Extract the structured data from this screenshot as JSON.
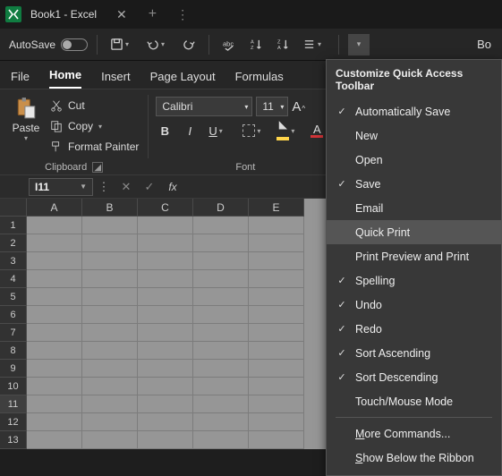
{
  "titlebar": {
    "doc": "Book1 - Excel"
  },
  "qat": {
    "autosave": "AutoSave",
    "toggle_state": "Off",
    "right_text": "Bo"
  },
  "tabs": [
    "File",
    "Home",
    "Insert",
    "Page Layout",
    "Formulas"
  ],
  "active_tab": 1,
  "clipboard": {
    "paste": "Paste",
    "cut": "Cut",
    "copy": "Copy",
    "format_painter": "Format Painter",
    "group_label": "Clipboard"
  },
  "font": {
    "name": "Calibri",
    "size": "11",
    "group_label": "Font"
  },
  "namebox": {
    "ref": "I11",
    "fx": "fx"
  },
  "columns": [
    "A",
    "B",
    "C",
    "D",
    "E"
  ],
  "rows": [
    "1",
    "2",
    "3",
    "4",
    "5",
    "6",
    "7",
    "8",
    "9",
    "10",
    "11",
    "12",
    "13"
  ],
  "selected_row": 11,
  "dropdown": {
    "title": "Customize Quick Access Toolbar",
    "items": [
      {
        "label": "Automatically Save",
        "checked": true
      },
      {
        "label": "New",
        "checked": false
      },
      {
        "label": "Open",
        "checked": false
      },
      {
        "label": "Save",
        "checked": true
      },
      {
        "label": "Email",
        "checked": false
      },
      {
        "label": "Quick Print",
        "checked": false,
        "hover": true
      },
      {
        "label": "Print Preview and Print",
        "checked": false
      },
      {
        "label": "Spelling",
        "checked": true
      },
      {
        "label": "Undo",
        "checked": true
      },
      {
        "label": "Redo",
        "checked": true
      },
      {
        "label": "Sort Ascending",
        "checked": true
      },
      {
        "label": "Sort Descending",
        "checked": true
      },
      {
        "label": "Touch/Mouse Mode",
        "checked": false
      }
    ],
    "more": "More Commands...",
    "below": "Show Below the Ribbon",
    "more_ul": "M",
    "below_ul": "S"
  }
}
